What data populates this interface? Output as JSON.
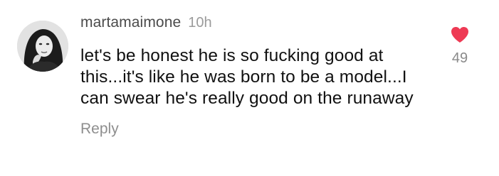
{
  "comment": {
    "username": "martamaimone",
    "time": "10h",
    "text": "let's be honest he is so fucking good at this...it's like he was born to be a model...I can swear he's really good on the runaway",
    "reply_label": "Reply",
    "like_count": "49",
    "like_icon": "heart-icon",
    "like_color": "#ee3a54"
  }
}
